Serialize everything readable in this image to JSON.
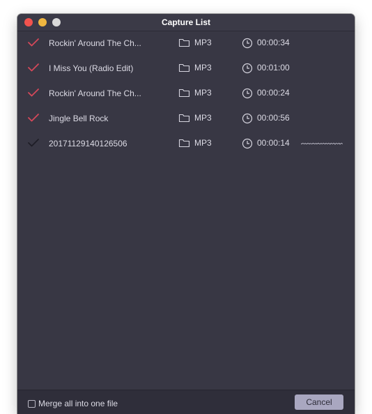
{
  "window": {
    "title": "Capture List"
  },
  "colors": {
    "check_done": "#d5485a",
    "check_pending": "#1f1e27",
    "background": "#383744",
    "footer": "#2f2e3a",
    "button": "#a9a7c0"
  },
  "icons": {
    "check": "checkmark-icon",
    "folder": "folder-icon",
    "clock": "clock-icon",
    "waveform": "waveform-icon"
  },
  "captures": [
    {
      "name": "Rockin' Around The Ch...",
      "format": "MP3",
      "duration": "00:00:34",
      "completed": true
    },
    {
      "name": "I Miss You (Radio Edit)",
      "format": "MP3",
      "duration": "00:01:00",
      "completed": true
    },
    {
      "name": "Rockin' Around The Ch...",
      "format": "MP3",
      "duration": "00:00:24",
      "completed": true
    },
    {
      "name": "Jingle Bell Rock",
      "format": "MP3",
      "duration": "00:00:56",
      "completed": true
    },
    {
      "name": "20171129140126506",
      "format": "MP3",
      "duration": "00:00:14",
      "completed": false,
      "recording": true
    }
  ],
  "footer": {
    "merge_label": "Merge all into one file",
    "merge_checked": false,
    "cancel_label": "Cancel"
  }
}
